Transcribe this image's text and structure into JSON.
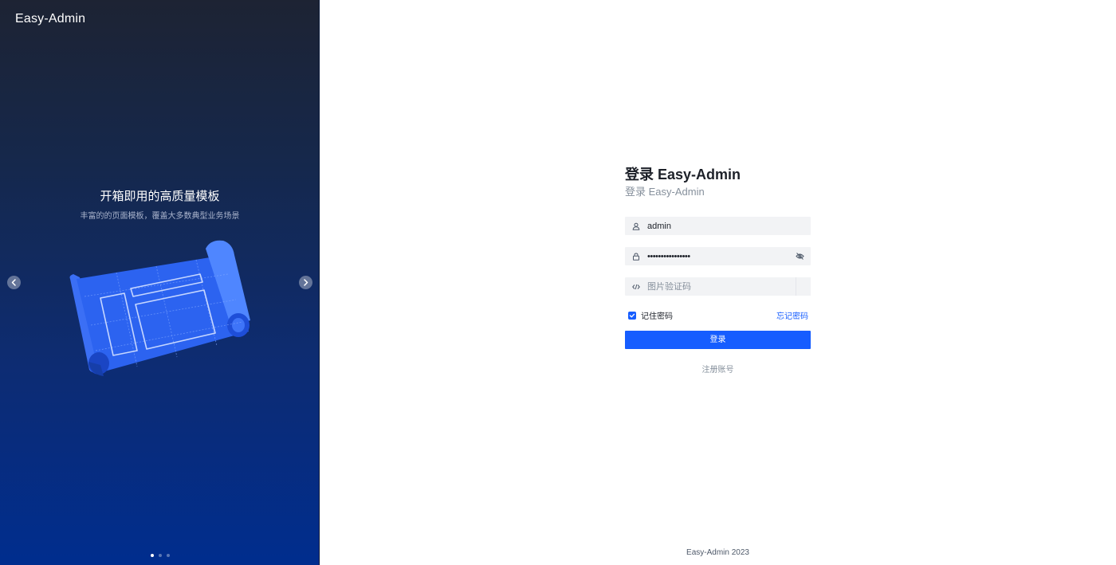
{
  "brand": {
    "name": "Easy-Admin"
  },
  "carousel": {
    "title": "开箱即用的高质量模板",
    "subtitle": "丰富的的页面模板，覆盖大多数典型业务场景",
    "prev_icon": "chevron-left-icon",
    "next_icon": "chevron-right-icon",
    "slide_count": 3,
    "active_slide": 1
  },
  "login": {
    "title": "登录 Easy-Admin",
    "subtitle": "登录 Easy-Admin",
    "username": {
      "value": "admin",
      "icon": "user-icon"
    },
    "password": {
      "value": "••••••••••••••••",
      "icon": "lock-icon",
      "toggle_icon": "eye-off-icon"
    },
    "captcha": {
      "placeholder": "图片验证码",
      "icon": "code-icon"
    },
    "remember_label": "记住密码",
    "remember_checked": true,
    "forgot_label": "忘记密码",
    "submit_label": "登录",
    "register_label": "注册账号"
  },
  "footer": {
    "text": "Easy-Admin 2023"
  },
  "colors": {
    "primary": "#165dff",
    "left_gradient_top": "#1d2333",
    "left_gradient_bottom": "#002d8e"
  }
}
